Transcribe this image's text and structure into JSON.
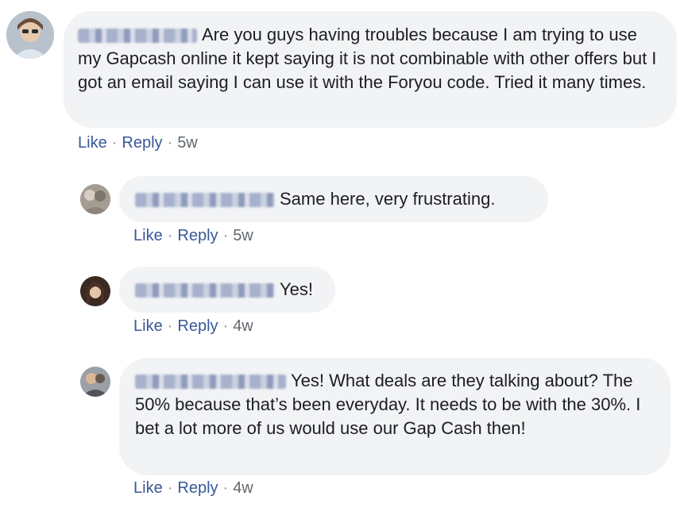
{
  "comments": [
    {
      "text": "Are you guys having troubles because I am trying to use my Gapcash online it kept saying it is not combinable with other offers but I got an email saying I can use it with the Foryou code. Tried it many times.",
      "actions": {
        "like": "Like",
        "reply": "Reply",
        "time": "5w"
      }
    },
    {
      "text": "Same here, very frustrating.",
      "actions": {
        "like": "Like",
        "reply": "Reply",
        "time": "5w"
      }
    },
    {
      "text": "Yes!",
      "actions": {
        "like": "Like",
        "reply": "Reply",
        "time": "4w"
      }
    },
    {
      "text": "Yes! What deals are they talking about? The 50% because that’s been everyday. It needs to be with the 30%. I bet a lot more of us would use our Gap Cash then!",
      "actions": {
        "like": "Like",
        "reply": "Reply",
        "time": "4w"
      }
    }
  ],
  "separator": "·",
  "colors": {
    "link": "#385898",
    "bubble": "#f2f3f5",
    "meta": "#616770"
  }
}
